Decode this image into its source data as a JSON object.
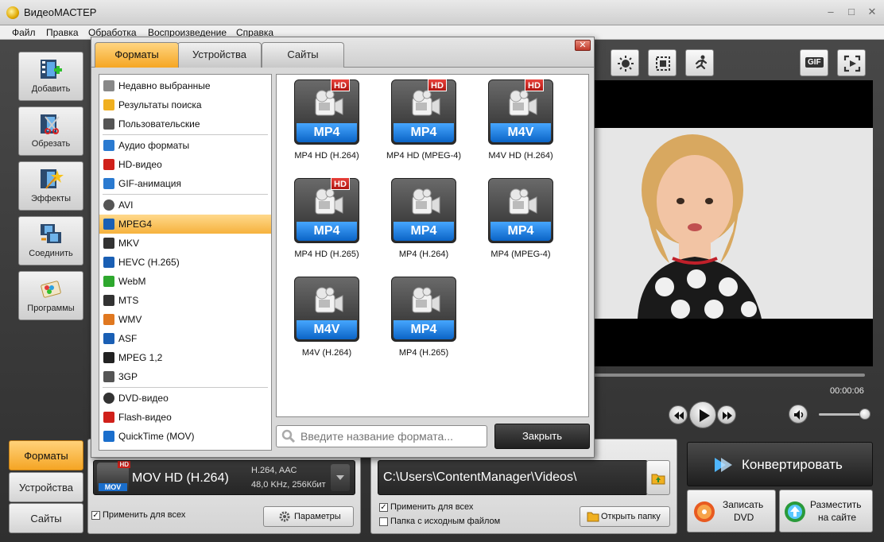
{
  "app": {
    "title": "ВидеоМАСТЕР"
  },
  "menu": [
    "Файл",
    "Правка",
    "Обработка",
    "Воспроизведение",
    "Справка"
  ],
  "sidebar": {
    "items": [
      {
        "label": "Добавить",
        "icon": "add-video-icon"
      },
      {
        "label": "Обрезать",
        "icon": "cut-icon"
      },
      {
        "label": "Эффекты",
        "icon": "effects-icon"
      },
      {
        "label": "Соединить",
        "icon": "join-icon"
      },
      {
        "label": "Программы",
        "icon": "programs-icon"
      }
    ]
  },
  "dialog": {
    "tabs": [
      {
        "label": "Форматы",
        "active": true
      },
      {
        "label": "Устройства",
        "active": false
      },
      {
        "label": "Сайты",
        "active": false
      }
    ],
    "categories": [
      {
        "label": "Недавно выбранные",
        "icon": "recent-icon"
      },
      {
        "label": "Результаты поиска",
        "icon": "search-results-icon"
      },
      {
        "label": "Пользовательские",
        "icon": "user-icon"
      },
      {
        "label": "Аудио форматы",
        "icon": "music-note-icon"
      },
      {
        "label": "HD-видео",
        "icon": "hd-icon"
      },
      {
        "label": "GIF-анимация",
        "icon": "gif-icon"
      },
      {
        "label": "AVI",
        "icon": "avi-icon"
      },
      {
        "label": "MPEG4",
        "icon": "mpeg4-icon",
        "selected": true
      },
      {
        "label": "MKV",
        "icon": "mkv-icon"
      },
      {
        "label": "HEVC (H.265)",
        "icon": "hevc-icon"
      },
      {
        "label": "WebM",
        "icon": "webm-icon"
      },
      {
        "label": "MTS",
        "icon": "mts-icon"
      },
      {
        "label": "WMV",
        "icon": "wmv-icon"
      },
      {
        "label": "ASF",
        "icon": "asf-icon"
      },
      {
        "label": "MPEG 1,2",
        "icon": "mpeg12-icon"
      },
      {
        "label": "3GP",
        "icon": "phone-icon"
      },
      {
        "label": "DVD-видео",
        "icon": "dvd-icon"
      },
      {
        "label": "Flash-видео",
        "icon": "flash-icon"
      },
      {
        "label": "QuickTime (MOV)",
        "icon": "quicktime-icon"
      }
    ],
    "formats": [
      {
        "badge": "MP4",
        "hd": true,
        "name": "MP4 HD (H.264)"
      },
      {
        "badge": "MP4",
        "hd": true,
        "name": "MP4 HD (MPEG-4)"
      },
      {
        "badge": "M4V",
        "hd": true,
        "name": "M4V HD (H.264)"
      },
      {
        "badge": "MP4",
        "hd": true,
        "name": "MP4 HD (H.265)"
      },
      {
        "badge": "MP4",
        "hd": false,
        "name": "MP4 (H.264)"
      },
      {
        "badge": "MP4",
        "hd": false,
        "name": "MP4 (MPEG-4)"
      },
      {
        "badge": "M4V",
        "hd": false,
        "name": "M4V (H.264)"
      },
      {
        "badge": "MP4",
        "hd": false,
        "name": "MP4 (H.265)"
      }
    ],
    "hd_label": "HD",
    "search_placeholder": "Введите название формата...",
    "close_label": "Закрыть"
  },
  "preview": {
    "timecode": "00:00:06",
    "gif_label": "GIF"
  },
  "bottom": {
    "tabs": [
      {
        "label": "Форматы",
        "active": true
      },
      {
        "label": "Устройства",
        "active": false
      },
      {
        "label": "Сайты",
        "active": false
      }
    ],
    "format": {
      "name": "MOV HD (H.264)",
      "icon_badge": "MOV",
      "hd_label": "HD",
      "codec_line1": "H.264, AAC",
      "codec_line2": "48,0 KHz, 256Кбит",
      "apply_all": "Применить для всех",
      "params_label": "Параметры"
    },
    "output": {
      "path": "C:\\Users\\ContentManager\\Videos\\",
      "apply_all": "Применить для всех",
      "same_folder": "Папка с исходным файлом",
      "open_folder": "Открыть папку"
    },
    "convert": {
      "label": "Конвертировать",
      "dvd_line1": "Записать",
      "dvd_line2": "DVD",
      "web_line1": "Разместить",
      "web_line2": "на сайте"
    }
  },
  "colors": {
    "accent_orange": "#f5a623",
    "badge_blue": "#0b64c6",
    "hd_red": "#d0201a"
  }
}
